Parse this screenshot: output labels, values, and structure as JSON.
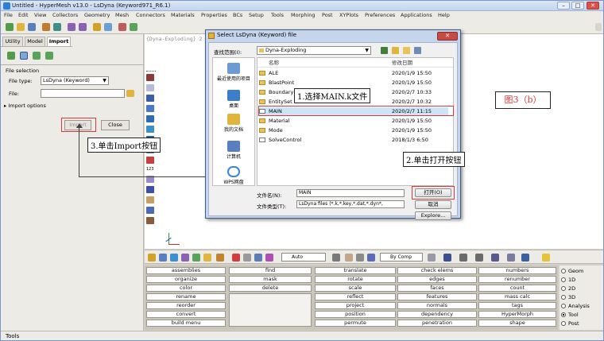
{
  "window": {
    "title": "Untitled - HyperMesh v13.0 - LsDyna (Keyword971_R6.1)",
    "controls": [
      "–",
      "□",
      "✕"
    ]
  },
  "menu": [
    "File",
    "Edit",
    "View",
    "Collectors",
    "Geometry",
    "Mesh",
    "Connectors",
    "Materials",
    "Properties",
    "BCs",
    "Setup",
    "Tools",
    "Morphing",
    "Post",
    "XYPlots",
    "Preferences",
    "Applications",
    "Help"
  ],
  "left_panel": {
    "tabs": [
      "Utility",
      "Model",
      "Import"
    ],
    "active_tab": "Import",
    "section": "File selection",
    "file_type_label": "File type:",
    "file_type_value": "LsDyna (Keyword)",
    "file_label": "File:",
    "file_value": "",
    "import_options": "Import options",
    "import_button": "Import",
    "close_button": "Close"
  },
  "graphics": {
    "header": "{Dyna-Exploding} 2",
    "tool_label": "123"
  },
  "bottom_toolbar": {
    "auto_select": "Auto",
    "by_comp_select": "By Comp"
  },
  "panel_grid": {
    "col1": [
      "assemblies",
      "organize",
      "color",
      "rename",
      "reorder",
      "convert",
      "build menu"
    ],
    "col2": [
      "find",
      "mask",
      "delete",
      "",
      "",
      "",
      ""
    ],
    "col3": [
      "translate",
      "rotate",
      "scale",
      "reflect",
      "project",
      "position",
      "permute"
    ],
    "col4": [
      "check elems",
      "edges",
      "faces",
      "features",
      "normals",
      "dependency",
      "penetration"
    ],
    "col5": [
      "numbers",
      "renumber",
      "count",
      "mass calc",
      "tags",
      "HyperMorph",
      "shape"
    ]
  },
  "radios": {
    "items": [
      "Geom",
      "1D",
      "2D",
      "3D",
      "Analysis",
      "Tool",
      "Post"
    ],
    "selected": "Tool"
  },
  "status": "Tools",
  "dialog": {
    "title": "Select LsDyna (Keyword) file",
    "close": "✕",
    "look_in_label": "查找范围(I):",
    "look_in_value": "Dyna-Exploding",
    "col_name": "名称",
    "col_date": "修改日期",
    "places": [
      "最近使用的项目",
      "桌面",
      "我的文档",
      "计算机",
      "WPS网盘"
    ],
    "files": [
      {
        "name": "ALE",
        "date": "2020/1/9 15:50"
      },
      {
        "name": "BlastPoint",
        "date": "2020/1/9 15:50"
      },
      {
        "name": "Boundary",
        "date": "2020/2/7 10:33"
      },
      {
        "name": "EntitySet",
        "date": "2020/2/7 10:32"
      },
      {
        "name": "MAIN",
        "date": "2020/2/7 11:15"
      },
      {
        "name": "Material",
        "date": "2020/1/9 15:50"
      },
      {
        "name": "Mode",
        "date": "2020/1/9 15:50"
      },
      {
        "name": "SolveControl",
        "date": "2018/1/3 6:50"
      }
    ],
    "filename_label": "文件名(N):",
    "filename_value": "MAIN",
    "filetype_label": "文件类型(T):",
    "filetype_value": "LsDyna files (*.k,*.key,*.dat,*.dyn*,",
    "open_button": "打开(O)",
    "cancel_button": "取消",
    "explore_button": "Explore..."
  },
  "annotations": {
    "step1": "1.选择MAIN.k文件",
    "step2": "2.单击打开按钮",
    "step3": "3.单击Import按钮",
    "figure": "图3（b）"
  },
  "colors": {
    "highlight": "#d23c3c",
    "selection": "#cde3f8",
    "dialog_frame": "#c5d6ec"
  }
}
